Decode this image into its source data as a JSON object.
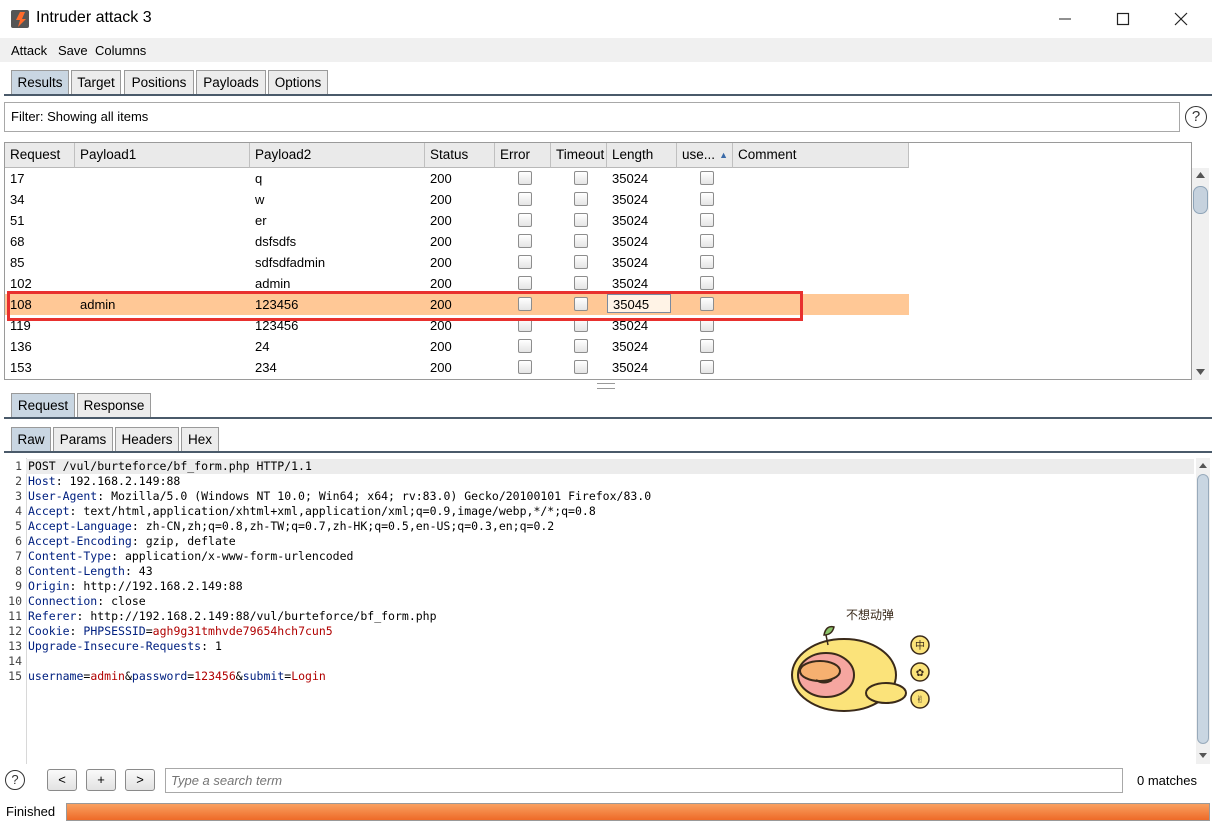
{
  "window": {
    "title": "Intruder attack 3",
    "minimize": "—",
    "maximize": "☐",
    "close": "✕"
  },
  "menu": [
    "Attack",
    "Save",
    "Columns"
  ],
  "tabs": [
    "Results",
    "Target",
    "Positions",
    "Payloads",
    "Options"
  ],
  "filter": {
    "text": "Filter: Showing all items",
    "help": "?"
  },
  "table": {
    "columns": [
      "Request",
      "Payload1",
      "Payload2",
      "Status",
      "Error",
      "Timeout",
      "Length",
      "use...",
      "Comment"
    ],
    "sort_indicator": "▲",
    "rows": [
      {
        "request": "17",
        "payload1": "",
        "payload2": "q",
        "status": "200",
        "length": "35024"
      },
      {
        "request": "34",
        "payload1": "",
        "payload2": "w",
        "status": "200",
        "length": "35024"
      },
      {
        "request": "51",
        "payload1": "",
        "payload2": "er",
        "status": "200",
        "length": "35024"
      },
      {
        "request": "68",
        "payload1": "",
        "payload2": "dsfsdfs",
        "status": "200",
        "length": "35024"
      },
      {
        "request": "85",
        "payload1": "",
        "payload2": "sdfsdfadmin",
        "status": "200",
        "length": "35024"
      },
      {
        "request": "102",
        "payload1": "",
        "payload2": "admin",
        "status": "200",
        "length": "35024"
      },
      {
        "request": "108",
        "payload1": "admin",
        "payload2": "123456",
        "status": "200",
        "length": "35045",
        "selected": true
      },
      {
        "request": "119",
        "payload1": "",
        "payload2": "123456",
        "status": "200",
        "length": "35024"
      },
      {
        "request": "136",
        "payload1": "",
        "payload2": "24",
        "status": "200",
        "length": "35024"
      },
      {
        "request": "153",
        "payload1": "",
        "payload2": "234",
        "status": "200",
        "length": "35024"
      }
    ]
  },
  "req_tabs": [
    "Request",
    "Response"
  ],
  "view_tabs": [
    "Raw",
    "Params",
    "Headers",
    "Hex"
  ],
  "request_lines": [
    {
      "n": "1",
      "k": "",
      "v": "POST /vul/burteforce/bf_form.php HTTP/1.1"
    },
    {
      "n": "2",
      "k": "Host",
      "v": " 192.168.2.149:88"
    },
    {
      "n": "3",
      "k": "User-Agent",
      "v": " Mozilla/5.0 (Windows NT 10.0; Win64; x64; rv:83.0) Gecko/20100101 Firefox/83.0"
    },
    {
      "n": "4",
      "k": "Accept",
      "v": " text/html,application/xhtml+xml,application/xml;q=0.9,image/webp,*/*;q=0.8"
    },
    {
      "n": "5",
      "k": "Accept-Language",
      "v": " zh-CN,zh;q=0.8,zh-TW;q=0.7,zh-HK;q=0.5,en-US;q=0.3,en;q=0.2"
    },
    {
      "n": "6",
      "k": "Accept-Encoding",
      "v": " gzip, deflate"
    },
    {
      "n": "7",
      "k": "Content-Type",
      "v": " application/x-www-form-urlencoded"
    },
    {
      "n": "8",
      "k": "Content-Length",
      "v": " 43"
    },
    {
      "n": "9",
      "k": "Origin",
      "v": " http://192.168.2.149:88"
    },
    {
      "n": "10",
      "k": "Connection",
      "v": " close"
    },
    {
      "n": "11",
      "k": "Referer",
      "v": " http://192.168.2.149:88/vul/burteforce/bf_form.php"
    },
    {
      "n": "12",
      "k": "Cookie",
      "v": " "
    },
    {
      "n": "13",
      "k": "Upgrade-Insecure-Requests",
      "v": " 1"
    },
    {
      "n": "14",
      "k": "",
      "v": ""
    },
    {
      "n": "15",
      "k": "",
      "v": ""
    }
  ],
  "cookie": {
    "name": "PHPSESSID",
    "eq": "=",
    "value": "agh9g31tmhvde79654hch7cun5"
  },
  "body_params": {
    "p1": "username",
    "v1": "admin",
    "p2": "password",
    "v2": "123456",
    "p3": "submit",
    "v3": "Login",
    "eq": "=",
    "amp": "&"
  },
  "sticker": {
    "caption": "不想动弹",
    "side_marks": [
      "中",
      "✿",
      "✌"
    ]
  },
  "search": {
    "prev": "<",
    "add": "+",
    "next": ">",
    "placeholder": "Type a search term",
    "matches": "0 matches",
    "help": "?"
  },
  "status": {
    "text": "Finished",
    "progress": 1.0
  },
  "colors": {
    "selected_row": "#ffc896",
    "highlight_box": "#e8302e",
    "progress": "#f07a3a",
    "tab_active": "#c9d6e2"
  }
}
